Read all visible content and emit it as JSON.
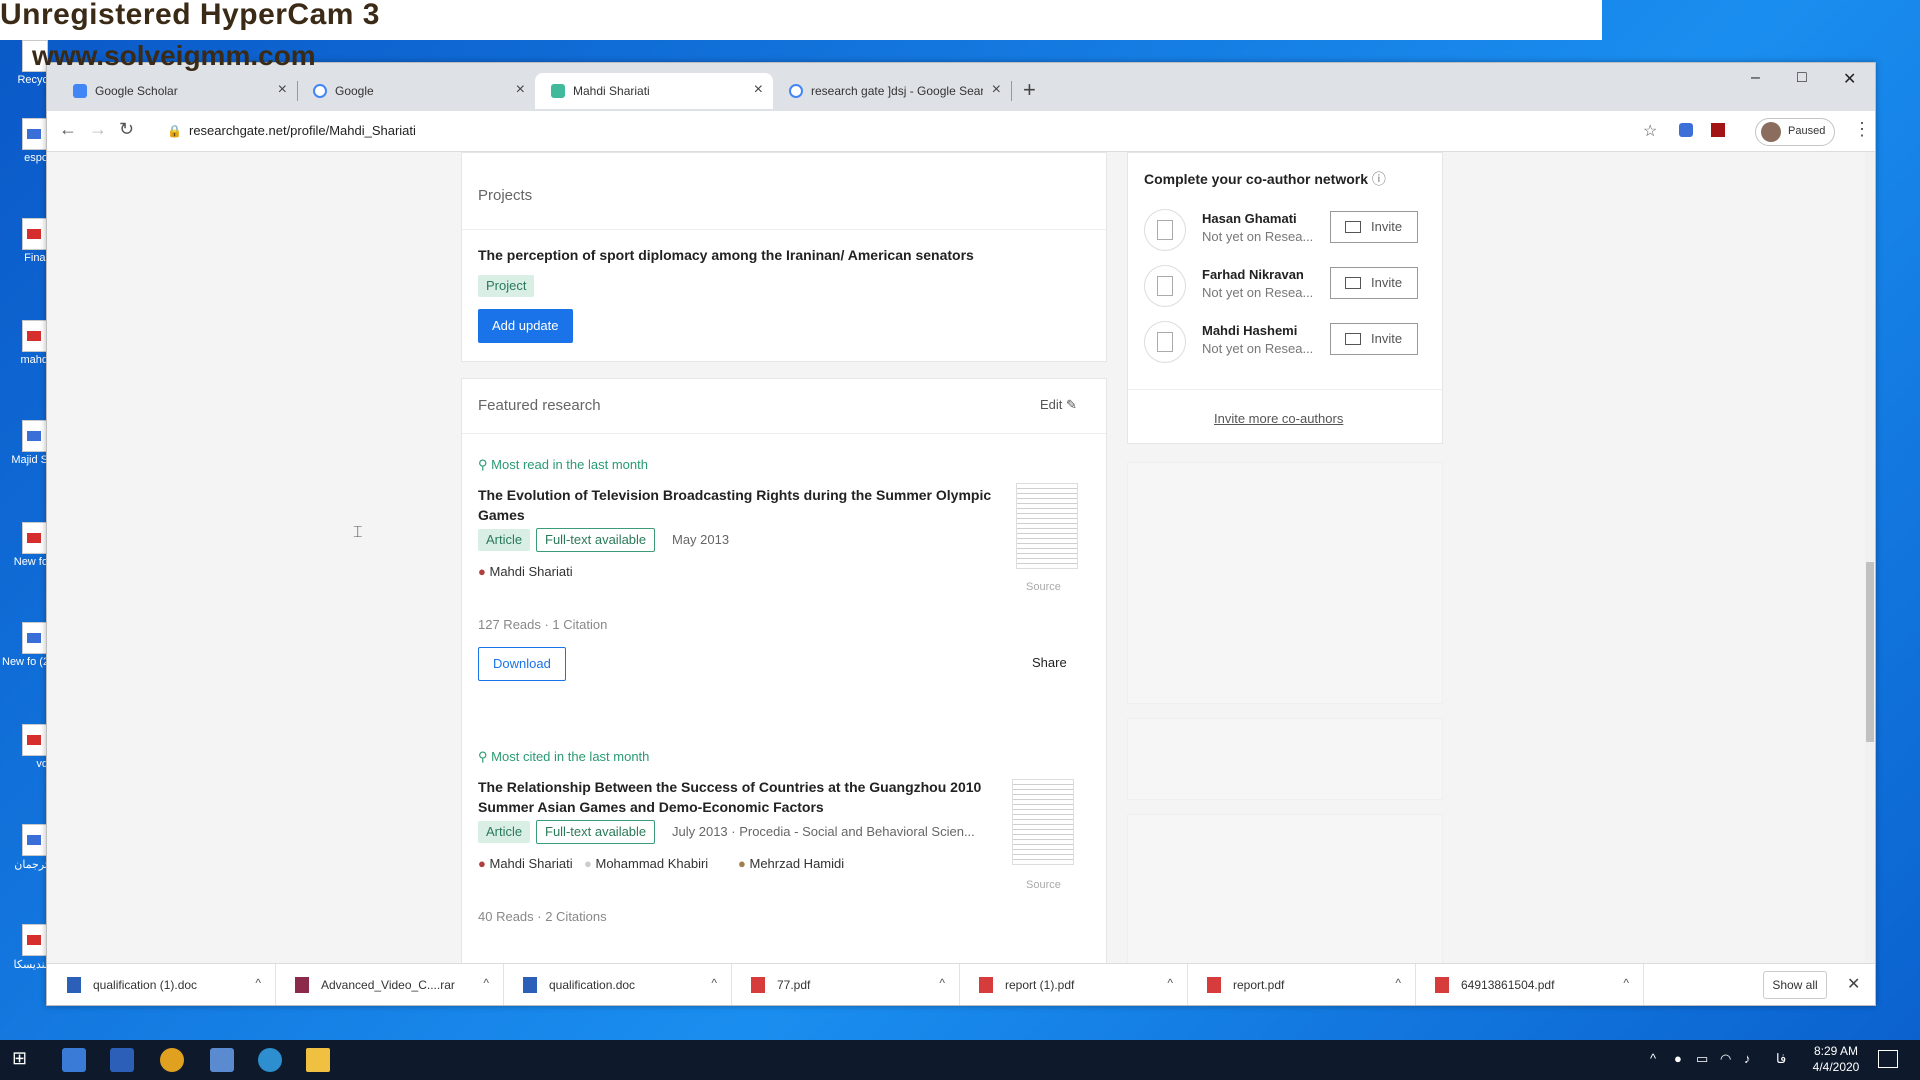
{
  "recorder": {
    "title": "Unregistered HyperCam 3",
    "url": "www.solveigmm.com"
  },
  "desktop_icons": [
    {
      "label": "Recyc",
      "icon": "recycle-bin-icon"
    },
    {
      "label": "espo",
      "icon": "document-icon"
    },
    {
      "label": "Final",
      "icon": "pdf-icon"
    },
    {
      "label": "mahd",
      "icon": "pdf-icon"
    },
    {
      "label": "Majid S",
      "icon": "document-icon"
    },
    {
      "label": "New fo",
      "icon": "pdf-icon"
    },
    {
      "label": "New fo (2",
      "icon": "document-icon"
    },
    {
      "label": "vd",
      "icon": "winrar-icon"
    },
    {
      "label": "ترجمان",
      "icon": "document-icon"
    },
    {
      "label": "بندیسکا",
      "icon": "pdf-icon"
    }
  ],
  "browser": {
    "tabs": [
      {
        "title": "Google Scholar",
        "favicon": "google-scholar-icon",
        "active": false
      },
      {
        "title": "Google",
        "favicon": "google-icon",
        "active": false
      },
      {
        "title": "Mahdi Shariati",
        "favicon": "researchgate-icon",
        "active": true
      },
      {
        "title": "research gate ]dsj - Google Sear",
        "favicon": "google-icon",
        "active": false
      }
    ],
    "url": "researchgate.net/profile/Mahdi_Shariati",
    "profile_status": "Paused"
  },
  "projects": {
    "heading": "Projects",
    "title": "The perception of sport diplomacy among the Iraninan/ American senators",
    "tag": "Project",
    "add_update": "Add update"
  },
  "featured": {
    "heading": "Featured research",
    "edit_label": "Edit",
    "articles": [
      {
        "highlight": "Most read in the last month",
        "title": "The Evolution of Television Broadcasting Rights during the Summer Olympic Games",
        "type": "Article",
        "availability": "Full-text available",
        "date": "May 2013",
        "authors": [
          "Mahdi Shariati"
        ],
        "source_label": "Source",
        "stats": "127 Reads · 1 Citation",
        "download": "Download",
        "share": "Share"
      },
      {
        "highlight": "Most cited in the last month",
        "title": "The Relationship Between the Success of Countries at the Guangzhou 2010 Summer Asian Games and Demo-Economic Factors",
        "type": "Article",
        "availability": "Full-text available",
        "date": "July 2013 · Procedia - Social and Behavioral Scien...",
        "authors": [
          "Mahdi Shariati",
          "Mohammad Khabiri",
          "Mehrzad Hamidi"
        ],
        "source_label": "Source",
        "stats": "40 Reads · 2 Citations"
      }
    ]
  },
  "coauthors": {
    "heading": "Complete your co-author network",
    "people": [
      {
        "name": "Hasan Ghamati",
        "status": "Not yet on Resea...",
        "action": "Invite"
      },
      {
        "name": "Farhad Nikravan",
        "status": "Not yet on Resea...",
        "action": "Invite"
      },
      {
        "name": "Mahdi Hashemi",
        "status": "Not yet on Resea...",
        "action": "Invite"
      }
    ],
    "invite_more": "Invite more co-authors"
  },
  "downloads": {
    "items": [
      {
        "name": "qualification (1).doc",
        "icon": "word-doc-icon"
      },
      {
        "name": "Advanced_Video_C....rar",
        "icon": "winrar-icon"
      },
      {
        "name": "qualification.doc",
        "icon": "word-doc-icon"
      },
      {
        "name": "77.pdf",
        "icon": "pdf-icon"
      },
      {
        "name": "report (1).pdf",
        "icon": "pdf-icon"
      },
      {
        "name": "report.pdf",
        "icon": "pdf-icon"
      },
      {
        "name": "64913861504.pdf",
        "icon": "pdf-icon"
      }
    ],
    "show_all": "Show all"
  },
  "taskbar": {
    "time": "8:29 AM",
    "date": "4/4/2020",
    "lang": "فا"
  },
  "colors": {
    "accent": "#1a73e8",
    "green": "#2a9a72",
    "desktop": "#1a8ef0"
  }
}
